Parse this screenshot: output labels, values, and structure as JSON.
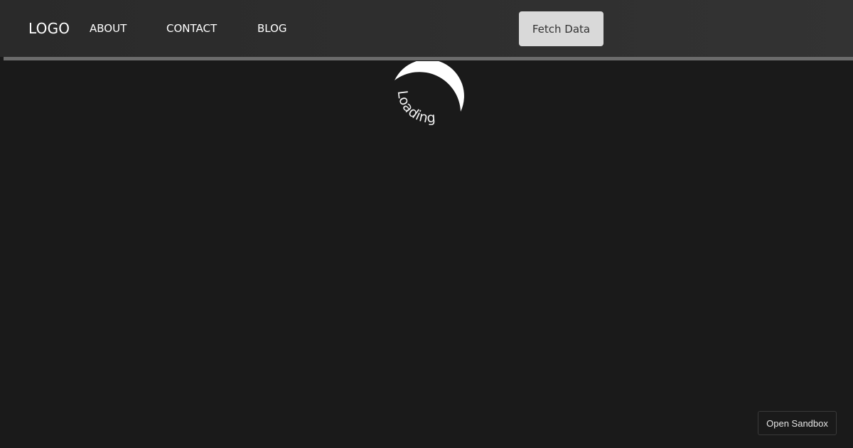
{
  "nav": {
    "logo": "LOGO",
    "links": [
      "ABOUT",
      "CONTACT",
      "BLOG"
    ],
    "fetch_button": "Fetch Data"
  },
  "progress": {
    "fraction": 1.0
  },
  "loader": {
    "label": "Loading"
  },
  "footer": {
    "sandbox_button": "Open Sandbox"
  },
  "colors": {
    "background": "#1a1a1a",
    "navbar": "#2e2e2e",
    "button": "#d9d9d9",
    "progress": "#6b6b6b",
    "spinner": "#ffffff"
  }
}
